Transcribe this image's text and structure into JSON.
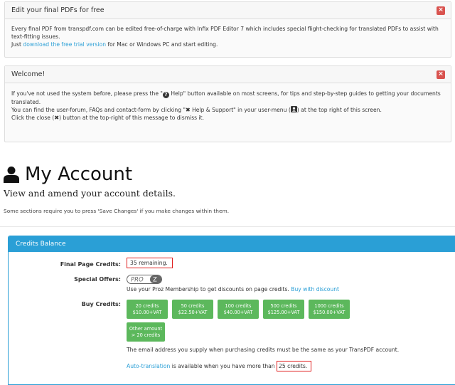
{
  "notices": {
    "pdf": {
      "title": "Edit your final PDFs for free",
      "close": "×",
      "line1": "Every final PDF from transpdf.com can be edited free-of-charge with Infix PDF Editor 7 which includes special flight-checking for translated PDFs to assist with text-fitting issues.",
      "line2_pre": "Just ",
      "line2_link": "download the free trial version",
      "line2_post": " for Mac or Windows PC and start editing."
    },
    "welcome": {
      "title": "Welcome!",
      "close": "×",
      "line1_pre": "If you've not used the system before, please press the \"",
      "help_glyph": "?",
      "line1_post": " Help\" button available on most screens, for tips and step-by-step guides to getting your documents translated.",
      "line2_pre": "You can find the user-forum, FAQs and contact-form by clicking \"",
      "support_glyph": "✖",
      "line2_mid": " Help & Support\" in your user-menu (",
      "line2_post": ") at the top right of this screen.",
      "line3_pre": "Click the close (",
      "close_glyph": "✖",
      "line3_post": ") button at the top-right of this message to dismiss it."
    }
  },
  "page": {
    "title": "My Account",
    "subtitle": "View and amend your account details.",
    "hint": "Some sections require you to press 'Save Changes' if you make changes within them."
  },
  "credits": {
    "header": "Credits Balance",
    "final_label": "Final Page Credits:",
    "final_value": "35 remaining.",
    "offers_label": "Special Offers:",
    "offers_text": "Use your Proz Membership to get discounts on page credits. ",
    "offers_link": "Buy with discount",
    "proz_logo_text": "PRO",
    "proz_logo_z": "Z",
    "buy_label": "Buy Credits:",
    "buttons": [
      {
        "line1": "20 credits",
        "line2": "$10.00+VAT"
      },
      {
        "line1": "50 credits",
        "line2": "$22.50+VAT"
      },
      {
        "line1": "100 credits",
        "line2": "$40.00+VAT"
      },
      {
        "line1": "500 credits",
        "line2": "$125.00+VAT"
      },
      {
        "line1": "1000 credits",
        "line2": "$150.00+VAT"
      },
      {
        "line1": "Other amount",
        "line2": "> 20 credits"
      }
    ],
    "email_note": "The email address you supply when purchasing credits must be the same as your TransPDF account.",
    "auto_link": "Auto-translation",
    "auto_mid": " is available when you have more than ",
    "auto_value": "25 credits."
  },
  "colors": {
    "accent": "#2a9fd6",
    "success": "#5cb85c",
    "danger": "#d9534f",
    "highlight": "#e02020"
  }
}
